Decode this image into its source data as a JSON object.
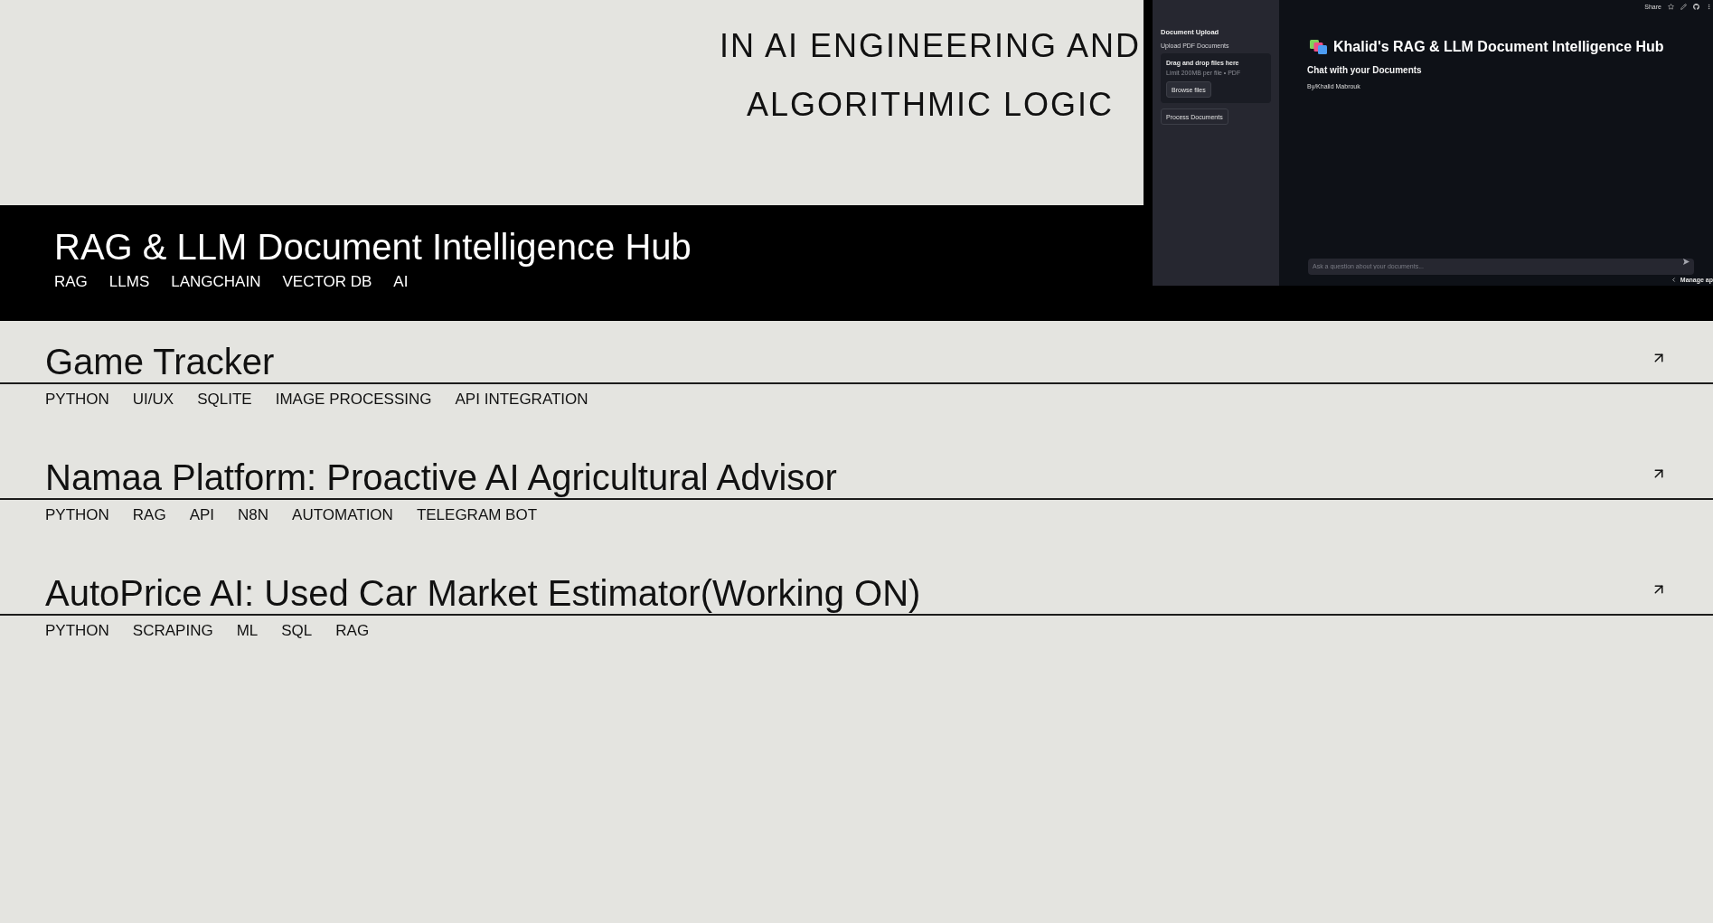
{
  "hero": {
    "lines": [
      "IN AI ENGINEERING AND",
      "ALGORITHMIC LOGIC"
    ]
  },
  "projects": [
    {
      "title": "RAG & LLM Document Intelligence Hub",
      "tags": [
        "RAG",
        "LLMS",
        "LANGCHAIN",
        "VECTOR DB",
        "AI"
      ],
      "hovered": true,
      "preview": {
        "sidebar": {
          "heading": "Document Upload",
          "uploader_label": "Upload PDF Documents",
          "dropzone": {
            "title": "Drag and drop files here",
            "hint": "Limit 200MB per file • PDF",
            "button": "Browse files"
          },
          "button": "Process Documents"
        },
        "toolbar": {
          "share": "Share"
        },
        "title": "Khalid's RAG & LLM Document Intelligence Hub",
        "subtitle": "Chat with your Documents",
        "byline": "By/Khalid Mabrouk",
        "chat_input": {
          "placeholder": "Ask a question about your documents..."
        },
        "manage_app": "Manage ap"
      }
    },
    {
      "title": "Game Tracker",
      "tags": [
        "PYTHON",
        "UI/UX",
        "SQLITE",
        "IMAGE PROCESSING",
        "API INTEGRATION"
      ],
      "hovered": false
    },
    {
      "title": "Namaa Platform: Proactive AI Agricultural Advisor",
      "tags": [
        "PYTHON",
        "RAG",
        "API",
        "N8N",
        "AUTOMATION",
        "TELEGRAM BOT"
      ],
      "hovered": false
    },
    {
      "title": "AutoPrice AI: Used Car Market Estimator(Working ON)",
      "tags": [
        "PYTHON",
        "SCRAPING",
        "ML",
        "SQL",
        "RAG"
      ],
      "hovered": false
    }
  ]
}
